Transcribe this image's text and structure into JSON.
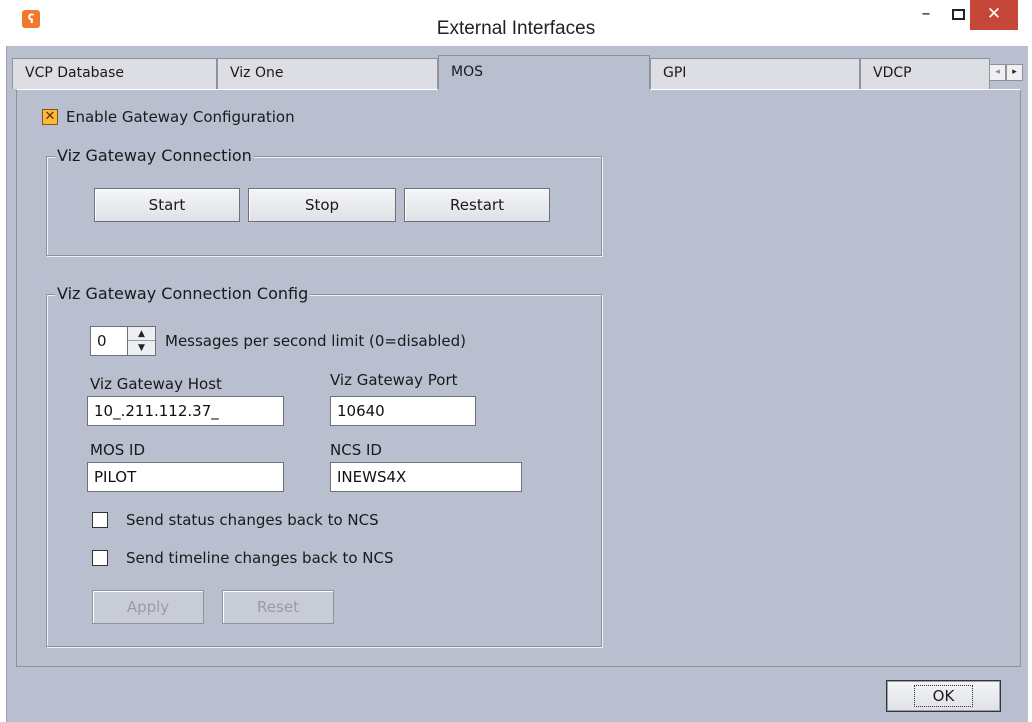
{
  "window": {
    "title": "External Interfaces",
    "icon": "app-logo-icon",
    "minimize_glyph": "–",
    "close_glyph": "✕"
  },
  "tabs": [
    {
      "label": "VCP Database",
      "active": false
    },
    {
      "label": "Viz One",
      "active": false
    },
    {
      "label": "MOS",
      "active": true
    },
    {
      "label": "GPI",
      "active": false
    },
    {
      "label": "VDCP",
      "active": false
    }
  ],
  "tab_scroll": {
    "left": "◂",
    "right": "▸"
  },
  "mos": {
    "enable_gateway_label": "Enable Gateway Configuration",
    "enable_gateway_checked": true,
    "connection_group": {
      "title": "Viz Gateway Connection",
      "start_label": "Start",
      "stop_label": "Stop",
      "restart_label": "Restart"
    },
    "config_group": {
      "title": "Viz Gateway Connection Config",
      "messages_limit_value": "0",
      "messages_limit_label": "Messages per second limit (0=disabled)",
      "host_label": "Viz Gateway Host",
      "host_value": "10_.211.112.37_",
      "port_label": "Viz Gateway Port",
      "port_value": "10640",
      "mos_id_label": "MOS ID",
      "mos_id_value": "PILOT",
      "ncs_id_label": "NCS ID",
      "ncs_id_value": "INEWS4X",
      "send_status_label": "Send status changes back to NCS",
      "send_status_checked": false,
      "send_timeline_label": "Send timeline changes back to NCS",
      "send_timeline_checked": false,
      "apply_label": "Apply",
      "reset_label": "Reset"
    }
  },
  "footer": {
    "ok_label": "OK"
  }
}
